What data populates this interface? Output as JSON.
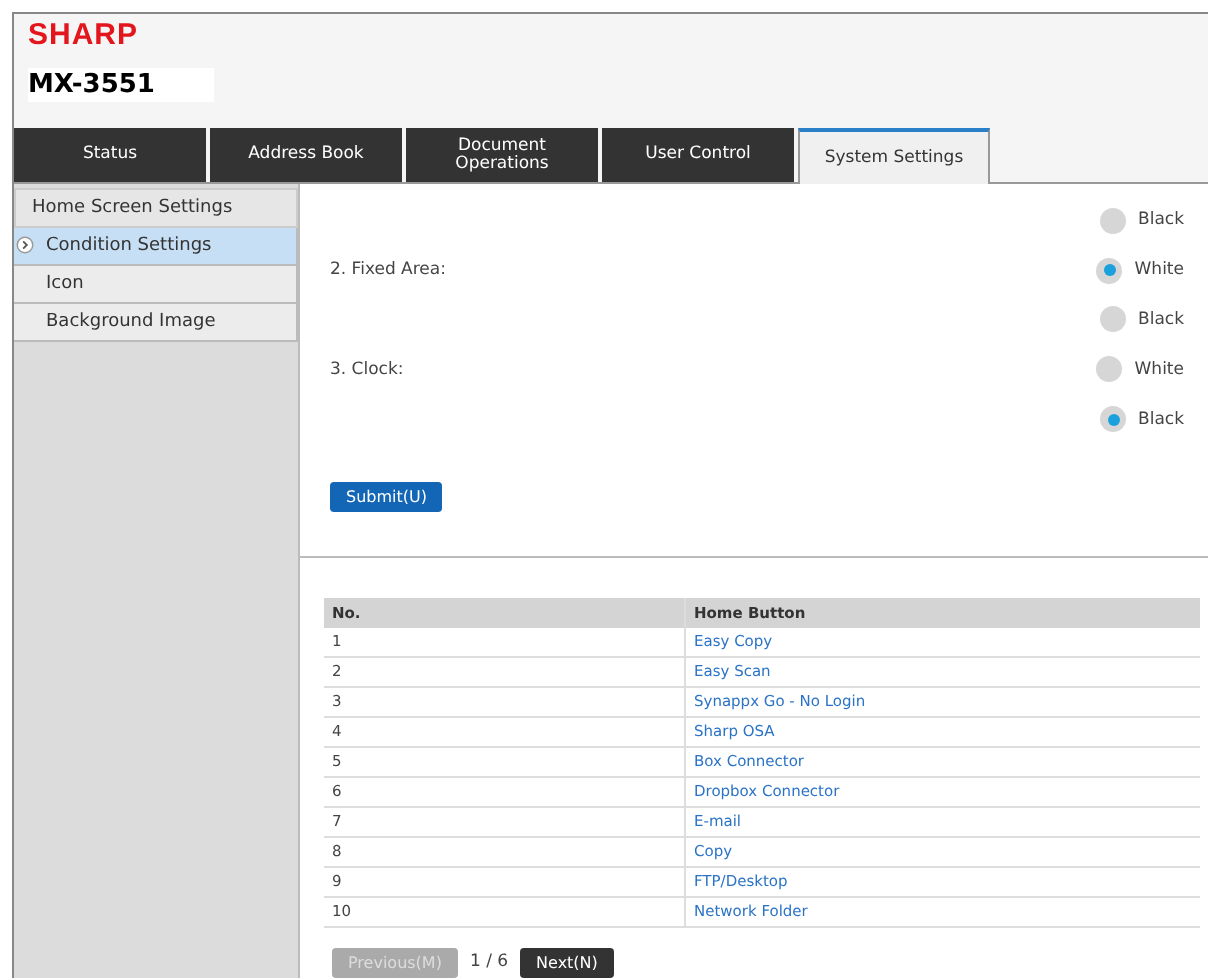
{
  "header": {
    "logo": "SHARP",
    "model": "MX-3551"
  },
  "tabs": [
    {
      "label": "Status",
      "selected": false
    },
    {
      "label": "Address Book",
      "selected": false
    },
    {
      "label": "Document Operations",
      "selected": false
    },
    {
      "label": "User Control",
      "selected": false
    },
    {
      "label": "System Settings",
      "selected": true
    }
  ],
  "sidebar": {
    "title": "Home Screen Settings",
    "items": [
      {
        "label": "Condition Settings",
        "selected": true
      },
      {
        "label": "Icon",
        "selected": false
      },
      {
        "label": "Background Image",
        "selected": false
      }
    ]
  },
  "options": [
    {
      "option": "Black",
      "selected": false
    },
    {
      "label": "2. Fixed Area:",
      "option": "White",
      "selected": true
    },
    {
      "option": "Black",
      "selected": false
    },
    {
      "label": "3. Clock:",
      "option": "White",
      "selected": false
    },
    {
      "option": "Black",
      "selected": true
    }
  ],
  "submit": "Submit(U)",
  "table": {
    "columns": [
      "No.",
      "Home Button"
    ],
    "rows": [
      [
        "1",
        "Easy Copy"
      ],
      [
        "2",
        "Easy Scan"
      ],
      [
        "3",
        "Synappx Go - No Login"
      ],
      [
        "4",
        "Sharp OSA"
      ],
      [
        "5",
        "Box Connector"
      ],
      [
        "6",
        "Dropbox Connector"
      ],
      [
        "7",
        "E-mail"
      ],
      [
        "8",
        "Copy"
      ],
      [
        "9",
        "FTP/Desktop"
      ],
      [
        "10",
        "Network Folder"
      ]
    ]
  },
  "pagination": {
    "previous": {
      "label": "Previous(M)",
      "disabled": true
    },
    "page": "1 / 6",
    "next": {
      "label": "Next(N)",
      "disabled": false
    }
  }
}
